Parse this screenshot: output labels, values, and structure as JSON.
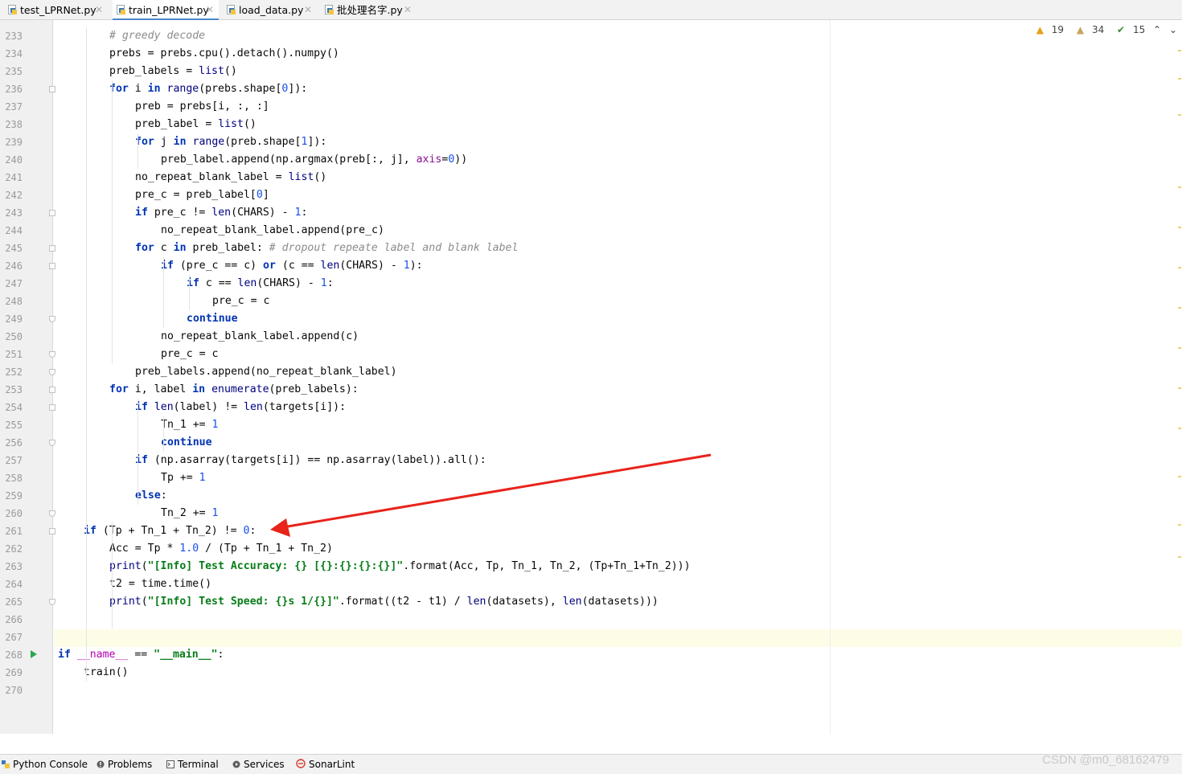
{
  "tabs": [
    {
      "label": "test_LPRNet.py",
      "active": false
    },
    {
      "label": "train_LPRNet.py",
      "active": true
    },
    {
      "label": "load_data.py",
      "active": false
    },
    {
      "label": "批处理名字.py",
      "active": false
    }
  ],
  "indicators": {
    "warnings": "19",
    "weak_warnings": "34",
    "typos": "15"
  },
  "bottom_tools": [
    {
      "label": "Python Console",
      "icon": "python-console-icon"
    },
    {
      "label": "Problems",
      "icon": "problems-icon"
    },
    {
      "label": "Terminal",
      "icon": "terminal-icon"
    },
    {
      "label": "Services",
      "icon": "services-icon"
    },
    {
      "label": "SonarLint",
      "icon": "sonarlint-icon"
    }
  ],
  "watermark": "CSDN @m0_68162479",
  "colors": {
    "keyword": "#0033b3",
    "string": "#067d17",
    "number": "#1750eb",
    "comment": "#8c8c8c",
    "arrow": "#e8231a",
    "caret_row": "#fdfce6"
  },
  "lines": [
    {
      "n": "233",
      "indent": 2,
      "tokens": [
        [
          "# greedy decode",
          "cm"
        ]
      ]
    },
    {
      "n": "234",
      "indent": 2,
      "tokens": [
        [
          "prebs = prebs.cpu().detach().numpy()",
          ""
        ]
      ]
    },
    {
      "n": "235",
      "indent": 2,
      "tokens": [
        [
          "preb_labels = ",
          ""
        ],
        [
          "list",
          "bi"
        ],
        [
          "()",
          ""
        ]
      ]
    },
    {
      "n": "236",
      "indent": 2,
      "tokens": [
        [
          "for",
          "kw"
        ],
        [
          " i ",
          ""
        ],
        [
          "in",
          "kw"
        ],
        [
          " ",
          ""
        ],
        [
          "range",
          "bi"
        ],
        [
          "(prebs.shape[",
          ""
        ],
        [
          "0",
          "num"
        ],
        [
          "]):",
          ""
        ]
      ]
    },
    {
      "n": "237",
      "indent": 3,
      "tokens": [
        [
          "preb = prebs[i, :, :]",
          ""
        ]
      ]
    },
    {
      "n": "238",
      "indent": 3,
      "tokens": [
        [
          "preb_label = ",
          ""
        ],
        [
          "list",
          "bi"
        ],
        [
          "()",
          ""
        ]
      ]
    },
    {
      "n": "239",
      "indent": 3,
      "tokens": [
        [
          "for",
          "kw"
        ],
        [
          " j ",
          ""
        ],
        [
          "in",
          "kw"
        ],
        [
          " ",
          ""
        ],
        [
          "range",
          "bi"
        ],
        [
          "(preb.shape[",
          ""
        ],
        [
          "1",
          "num"
        ],
        [
          "]):",
          ""
        ]
      ]
    },
    {
      "n": "240",
      "indent": 4,
      "tokens": [
        [
          "preb_label.append(np.argmax(preb[:, j], ",
          ""
        ],
        [
          "axis",
          "param"
        ],
        [
          "=",
          ""
        ],
        [
          "0",
          "num"
        ],
        [
          "))",
          ""
        ]
      ]
    },
    {
      "n": "241",
      "indent": 3,
      "tokens": [
        [
          "no_repeat_blank_label = ",
          ""
        ],
        [
          "list",
          "bi"
        ],
        [
          "()",
          ""
        ]
      ]
    },
    {
      "n": "242",
      "indent": 3,
      "tokens": [
        [
          "pre_c = preb_label[",
          ""
        ],
        [
          "0",
          "num"
        ],
        [
          "]",
          ""
        ]
      ]
    },
    {
      "n": "243",
      "indent": 3,
      "tokens": [
        [
          "if",
          "kw"
        ],
        [
          " pre_c != ",
          ""
        ],
        [
          "len",
          "bi"
        ],
        [
          "(CHARS) - ",
          ""
        ],
        [
          "1",
          "num"
        ],
        [
          ":",
          ""
        ]
      ]
    },
    {
      "n": "244",
      "indent": 4,
      "tokens": [
        [
          "no_repeat_blank_label.append(pre_c)",
          ""
        ]
      ]
    },
    {
      "n": "245",
      "indent": 3,
      "tokens": [
        [
          "for",
          "kw"
        ],
        [
          " c ",
          ""
        ],
        [
          "in",
          "kw"
        ],
        [
          " preb_label: ",
          ""
        ],
        [
          "# dropout repeate label and blank label",
          "cm"
        ]
      ]
    },
    {
      "n": "246",
      "indent": 4,
      "tokens": [
        [
          "if",
          "kw"
        ],
        [
          " (pre_c == c) ",
          ""
        ],
        [
          "or",
          "kw"
        ],
        [
          " (c == ",
          ""
        ],
        [
          "len",
          "bi"
        ],
        [
          "(CHARS) - ",
          ""
        ],
        [
          "1",
          "num"
        ],
        [
          "):",
          ""
        ]
      ]
    },
    {
      "n": "247",
      "indent": 5,
      "tokens": [
        [
          "if",
          "kw"
        ],
        [
          " c == ",
          ""
        ],
        [
          "len",
          "bi"
        ],
        [
          "(CHARS) - ",
          ""
        ],
        [
          "1",
          "num"
        ],
        [
          ":",
          ""
        ]
      ]
    },
    {
      "n": "248",
      "indent": 6,
      "tokens": [
        [
          "pre_c = c",
          ""
        ]
      ]
    },
    {
      "n": "249",
      "indent": 5,
      "tokens": [
        [
          "continue",
          "kw"
        ]
      ]
    },
    {
      "n": "250",
      "indent": 4,
      "tokens": [
        [
          "no_repeat_blank_label.append(c)",
          ""
        ]
      ]
    },
    {
      "n": "251",
      "indent": 4,
      "tokens": [
        [
          "pre_c = c",
          ""
        ]
      ]
    },
    {
      "n": "252",
      "indent": 3,
      "tokens": [
        [
          "preb_labels.append(no_repeat_blank_label)",
          ""
        ]
      ]
    },
    {
      "n": "253",
      "indent": 2,
      "tokens": [
        [
          "for",
          "kw"
        ],
        [
          " i, label ",
          ""
        ],
        [
          "in",
          "kw"
        ],
        [
          " ",
          ""
        ],
        [
          "enumerate",
          "bi"
        ],
        [
          "(preb_labels):",
          ""
        ]
      ]
    },
    {
      "n": "254",
      "indent": 3,
      "tokens": [
        [
          "if",
          "kw"
        ],
        [
          " ",
          ""
        ],
        [
          "len",
          "bi"
        ],
        [
          "(label) != ",
          ""
        ],
        [
          "len",
          "bi"
        ],
        [
          "(targets[i]):",
          ""
        ]
      ]
    },
    {
      "n": "255",
      "indent": 4,
      "tokens": [
        [
          "Tn_1 += ",
          ""
        ],
        [
          "1",
          "num"
        ]
      ]
    },
    {
      "n": "256",
      "indent": 4,
      "tokens": [
        [
          "continue",
          "kw"
        ]
      ]
    },
    {
      "n": "257",
      "indent": 3,
      "tokens": [
        [
          "if",
          "kw"
        ],
        [
          " (np.asarray(targets[i]) == np.asarray(label)).all():",
          ""
        ]
      ]
    },
    {
      "n": "258",
      "indent": 4,
      "tokens": [
        [
          "Tp += ",
          ""
        ],
        [
          "1",
          "num"
        ]
      ]
    },
    {
      "n": "259",
      "indent": 3,
      "tokens": [
        [
          "else",
          "kw"
        ],
        [
          ":",
          ""
        ]
      ]
    },
    {
      "n": "260",
      "indent": 4,
      "tokens": [
        [
          "Tn_2 += ",
          ""
        ],
        [
          "1",
          "num"
        ]
      ]
    },
    {
      "n": "261",
      "indent": 1,
      "tokens": [
        [
          "if",
          "kw"
        ],
        [
          " (Tp + Tn_1 + Tn_2) != ",
          ""
        ],
        [
          "0",
          "num"
        ],
        [
          ":",
          ""
        ]
      ]
    },
    {
      "n": "262",
      "indent": 2,
      "tokens": [
        [
          "Acc = Tp * ",
          ""
        ],
        [
          "1.0",
          "num"
        ],
        [
          " / (Tp + Tn_1 + Tn_2)",
          ""
        ]
      ]
    },
    {
      "n": "263",
      "indent": 2,
      "tokens": [
        [
          "print",
          "bi"
        ],
        [
          "(",
          ""
        ],
        [
          "\"[Info] Test Accuracy: {} [{}:{}:{}:{}]\"",
          "str"
        ],
        [
          ".format(Acc, Tp, Tn_1, Tn_2, (Tp+Tn_1+Tn_2)))",
          ""
        ]
      ]
    },
    {
      "n": "264",
      "indent": 2,
      "tokens": [
        [
          "t2 = time.time()",
          ""
        ]
      ]
    },
    {
      "n": "265",
      "indent": 2,
      "tokens": [
        [
          "print",
          "bi"
        ],
        [
          "(",
          ""
        ],
        [
          "\"[Info] Test Speed: {}s 1/{}]\"",
          "str"
        ],
        [
          ".format((t2 - t1) / ",
          ""
        ],
        [
          "len",
          "bi"
        ],
        [
          "(datasets), ",
          ""
        ],
        [
          "len",
          "bi"
        ],
        [
          "(datasets)))",
          ""
        ]
      ]
    },
    {
      "n": "266",
      "indent": 0,
      "tokens": []
    },
    {
      "n": "267",
      "indent": 0,
      "tokens": []
    },
    {
      "n": "268",
      "indent": 0,
      "tokens": [
        [
          "if",
          "kw"
        ],
        [
          " ",
          ""
        ],
        [
          "__name__",
          "dunder"
        ],
        [
          " == ",
          ""
        ],
        [
          "\"__main__\"",
          "str"
        ],
        [
          ":",
          ""
        ]
      ]
    },
    {
      "n": "269",
      "indent": 1,
      "tokens": [
        [
          "train()",
          ""
        ]
      ]
    },
    {
      "n": "270",
      "indent": 0,
      "tokens": []
    }
  ]
}
